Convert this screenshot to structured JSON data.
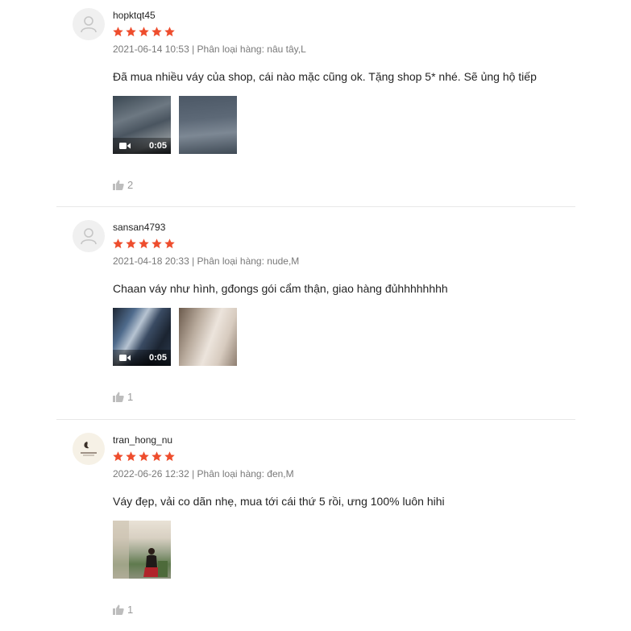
{
  "colors": {
    "star": "#ee4d2d",
    "meta": "rgba(0,0,0,.54)"
  },
  "reviews": [
    {
      "username": "hopktqt45",
      "rating": 5,
      "meta": "2021-06-14 10:53 | Phân loại hàng: nâu tây,L",
      "content": "Đã mua nhiều váy của shop, cái nào mặc cũng ok. Tặng shop 5* nhé. Sẽ ủng hộ tiếp",
      "media": [
        {
          "type": "video",
          "duration": "0:05",
          "icon": "video-camera-icon"
        },
        {
          "type": "image"
        }
      ],
      "likes": "2",
      "avatar": "default-user-icon"
    },
    {
      "username": "sansan4793",
      "rating": 5,
      "meta": "2021-04-18 20:33 | Phân loại hàng: nude,M",
      "content": "Chaan váy như hình, gđongs gói cẩm thận, giao hàng đủhhhhhhhh",
      "media": [
        {
          "type": "video",
          "duration": "0:05",
          "icon": "video-camera-icon"
        },
        {
          "type": "image"
        }
      ],
      "likes": "1",
      "avatar": "default-user-icon"
    },
    {
      "username": "tran_hong_nu",
      "rating": 5,
      "meta": "2022-06-26 12:32 | Phân loại hàng: đen,M",
      "content": "Váy đẹp, vải co dãn nhẹ, mua tới cái thứ 5 rồi, ưng 100% luôn hihi",
      "media": [
        {
          "type": "image"
        }
      ],
      "likes": "1",
      "avatar": "shop-logo-avatar"
    }
  ]
}
